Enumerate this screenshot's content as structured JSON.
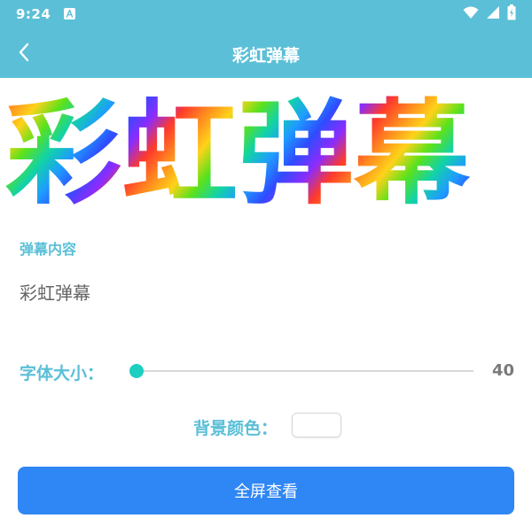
{
  "status_bar": {
    "time": "9:24",
    "app_notification_icon": "app-store-icon",
    "icons": [
      "wifi-icon",
      "signal-icon",
      "battery-icon"
    ]
  },
  "header": {
    "back_icon": "chevron-left-icon",
    "title": "彩虹弹幕"
  },
  "preview": {
    "text": "彩虹弹幕",
    "gradient_colors": [
      "#ff3a2b",
      "#ff8a1f",
      "#ffd21a",
      "#5ce21b",
      "#12d3a6",
      "#1e9cff",
      "#2f4cff",
      "#8a2cff",
      "#ff3a2b"
    ]
  },
  "content": {
    "label": "弹幕内容",
    "value": "彩虹弹幕"
  },
  "font_size": {
    "label": "字体大小：",
    "value": "40",
    "slider_fraction": 0.0
  },
  "background": {
    "label": "背景颜色：",
    "color": "#ffffff"
  },
  "actions": {
    "fullscreen_label": "全屏查看"
  },
  "colors": {
    "accent": "#5bbfd7",
    "button": "#2f86f5",
    "slider": "#1ccfc0"
  }
}
